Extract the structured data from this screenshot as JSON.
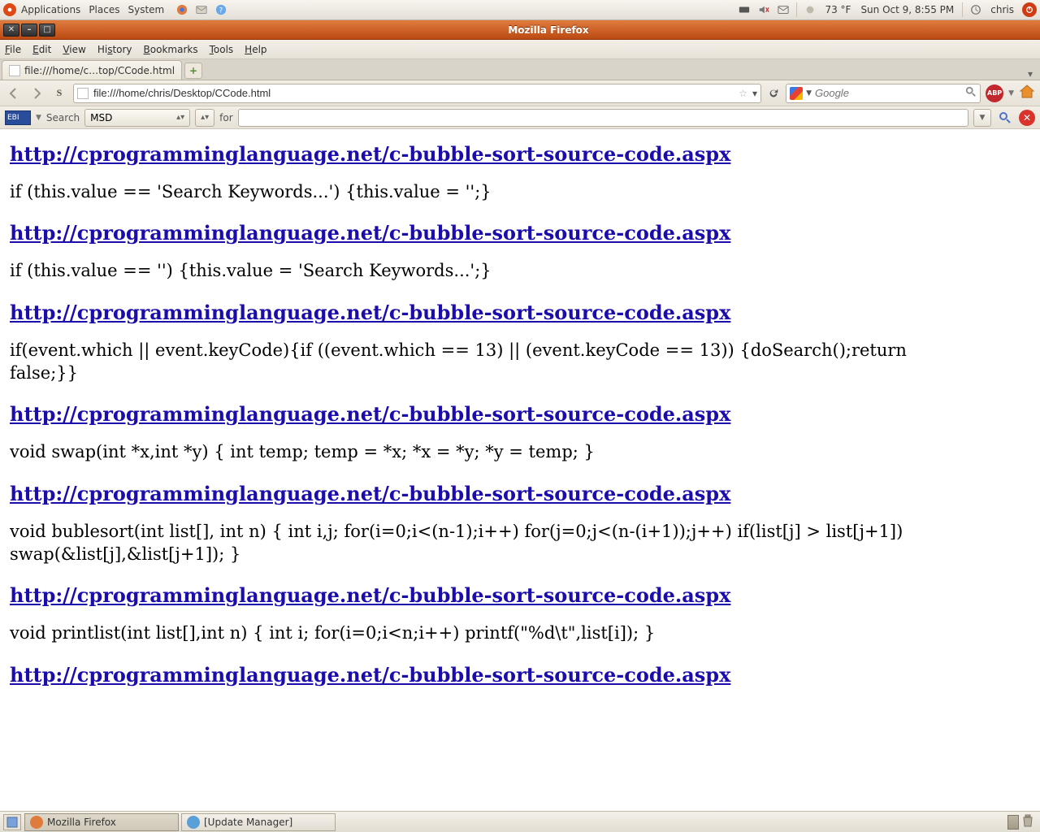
{
  "gnome": {
    "menus": [
      "Applications",
      "Places",
      "System"
    ],
    "temp": "73 °F",
    "clock": "Sun Oct  9,  8:55 PM",
    "user": "chris"
  },
  "window": {
    "title": "Mozilla Firefox"
  },
  "ff_menu": [
    {
      "l": "F",
      "rest": "ile"
    },
    {
      "l": "E",
      "rest": "dit"
    },
    {
      "l": "V",
      "rest": "iew"
    },
    {
      "l": "H",
      "rest": "i",
      "rest2": "story"
    },
    {
      "l": "B",
      "rest": "ookmarks"
    },
    {
      "l": "T",
      "rest": "ools"
    },
    {
      "l": "H",
      "rest": "elp"
    }
  ],
  "tab": {
    "label": "file:///home/c…top/CCode.html"
  },
  "url": "file:///home/chris/Desktop/CCode.html",
  "search": {
    "placeholder": "Google",
    "value": ""
  },
  "ext": {
    "logo": "EBI",
    "search_label": "Search",
    "engine": "MSD",
    "for_label": "for",
    "value": ""
  },
  "page": {
    "link": "http://cprogramminglanguage.net/c-bubble-sort-source-code.aspx",
    "blocks": [
      "if (this.value == 'Search Keywords...') {this.value = '';}",
      "if (this.value == '') {this.value = 'Search Keywords...';}",
      "if(event.which || event.keyCode){if ((event.which == 13) || (event.keyCode == 13)) {doSearch();return false;}}",
      "void swap(int *x,int *y) { int temp; temp = *x; *x = *y; *y = temp; }",
      "void bublesort(int list[], int n) { int i,j; for(i=0;i<(n-1);i++) for(j=0;j<(n-(i+1));j++) if(list[j] > list[j+1]) swap(&list[j],&list[j+1]); }",
      "void printlist(int list[],int n) { int i; for(i=0;i<n;i++) printf(\"%d\\t\",list[i]); }"
    ]
  },
  "taskbar": {
    "items": [
      {
        "label": "Mozilla Firefox",
        "active": true,
        "color": "#e07b3e"
      },
      {
        "label": "[Update Manager]",
        "active": false,
        "color": "#5aa0d8"
      }
    ]
  }
}
